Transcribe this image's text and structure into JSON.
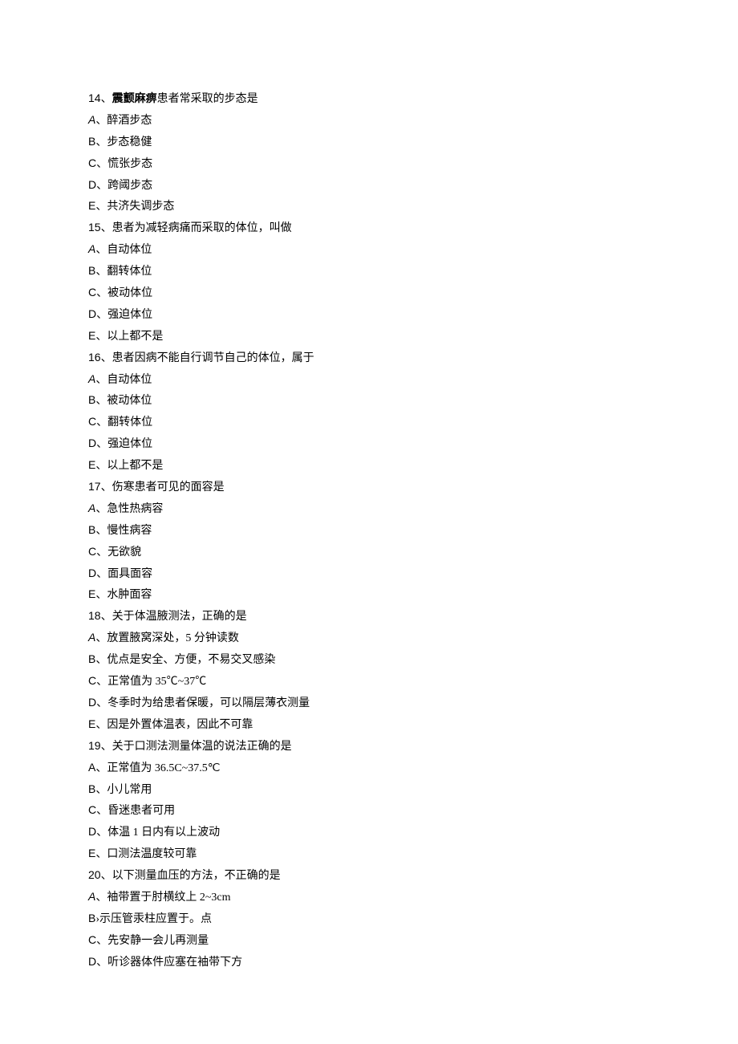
{
  "questions": [
    {
      "num": "14",
      "stem_bold": "震颤麻痹",
      "stem_rest": "患者常采取的步态是",
      "options": [
        {
          "label": "A",
          "text": "醉酒步态",
          "italic": true
        },
        {
          "label": "B",
          "text": "步态稳健"
        },
        {
          "label": "C",
          "text": "慌张步态"
        },
        {
          "label": "D",
          "text": "跨阈步态"
        },
        {
          "label": "E",
          "text": "共济失调步态"
        }
      ]
    },
    {
      "num": "15",
      "stem_rest": "患者为减轻病痛而采取的体位，叫做",
      "options": [
        {
          "label": "A",
          "text": "自动体位",
          "italic": true
        },
        {
          "label": "B",
          "text": "翻转体位"
        },
        {
          "label": "C",
          "text": "被动体位"
        },
        {
          "label": "D",
          "text": "强迫体位"
        },
        {
          "label": "E",
          "text": "以上都不是"
        }
      ]
    },
    {
      "num": "16",
      "stem_rest": "患者因病不能自行调节自己的体位，属于",
      "options": [
        {
          "label": "A",
          "text": "自动体位",
          "italic": true
        },
        {
          "label": "B",
          "text": "被动体位"
        },
        {
          "label": "C",
          "text": "翻转体位"
        },
        {
          "label": "D",
          "text": "强迫体位"
        },
        {
          "label": "E",
          "text": "以上都不是"
        }
      ]
    },
    {
      "num": "17",
      "stem_rest": "伤寒患者可见的面容是",
      "options": [
        {
          "label": "A",
          "text": "急性热病容",
          "italic": true
        },
        {
          "label": "B",
          "text": "慢性病容"
        },
        {
          "label": "C",
          "text": "无欲貌"
        },
        {
          "label": "D",
          "text": "面具面容"
        },
        {
          "label": "E",
          "text": "水肿面容"
        }
      ]
    },
    {
      "num": "18",
      "stem_rest": "关于体温腋测法，正确的是",
      "options": [
        {
          "label": "A",
          "text": "放置腋窝深处，5 分钟读数",
          "italic": true
        },
        {
          "label": "B",
          "text": "优点是安全、方便，不易交叉感染"
        },
        {
          "label": "C",
          "text": "正常值为 35℃~37℃"
        },
        {
          "label": "D",
          "text": "冬季时为给患者保暖，可以隔层薄衣测量"
        },
        {
          "label": "E",
          "text": "因是外置体温表，因此不可靠"
        }
      ]
    },
    {
      "num": "19",
      "stem_rest": "关于口测法测量体温的说法正确的是",
      "options": [
        {
          "label": "A",
          "text": "正常值为 36.5C~37.5℃"
        },
        {
          "label": "B",
          "text": "小儿常用"
        },
        {
          "label": "C",
          "text": "昏迷患者可用"
        },
        {
          "label": "D",
          "text": "体温 1 日内有以上波动"
        },
        {
          "label": "E",
          "text": "口测法温度较可靠"
        }
      ]
    },
    {
      "num": "20",
      "stem_rest": "以下测量血压的方法，不正确的是",
      "options": [
        {
          "label": "A",
          "text": "袖带置于肘横纹上 2~3cm",
          "italic": true
        },
        {
          "label": "B",
          "sep": "›",
          "text": "示压管汞柱应置于。点"
        },
        {
          "label": "C",
          "text": "先安静一会儿再测量"
        },
        {
          "label": "D",
          "text": "听诊器体件应塞在袖带下方"
        }
      ]
    }
  ]
}
